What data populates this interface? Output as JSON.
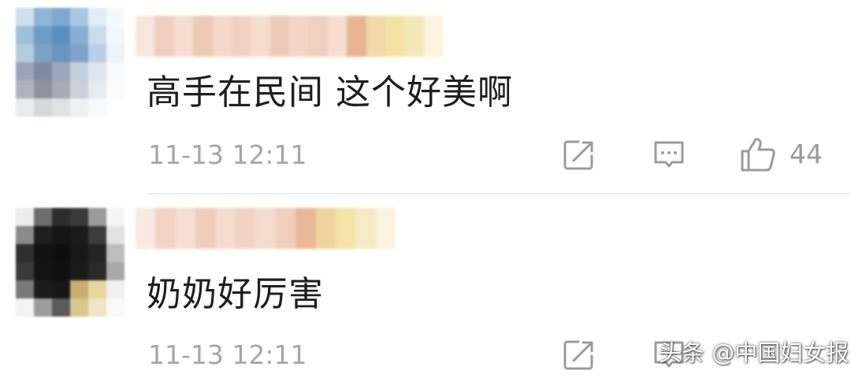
{
  "comments": [
    {
      "text": "高手在民间 这个好美啊",
      "timestamp": "11-13 12:11",
      "likes": "44",
      "avatar_palette": [
        "#cfe0ee",
        "#8fb6d8",
        "#7fa9d0",
        "#a9c7e2",
        "#e2eef7",
        "#f6f9fc",
        "#9fbfdc",
        "#6f9cc6",
        "#5d8fbd",
        "#88afd3",
        "#c9dcec",
        "#f3f7fb",
        "#b6cbe0",
        "#7fa1c3",
        "#6c94bc",
        "#7ea3c7",
        "#b9cfe3",
        "#eef3f8",
        "#9aa6b8",
        "#7f8aa2",
        "#9aa7bb",
        "#c4cfdc",
        "#dde5ee",
        "#f7f9fb",
        "#b0b3bd",
        "#8e939f",
        "#a6aab4",
        "#ccd0d8",
        "#e7eaee",
        "#fbfbfc",
        "#e9ebee",
        "#d4d7dc",
        "#dfe1e5",
        "#eef0f2",
        "#f8f9fa",
        "#ffffff"
      ],
      "username_palette": [
        "#f7e6dc",
        "#f0cfc0",
        "#f6ddd0",
        "#eccab6",
        "#f4d9cb",
        "#f1d2c2",
        "#f5dccf",
        "#eecbb8",
        "#f3d6c7",
        "#f0d0bf",
        "#f6ddcf",
        "#e8b592",
        "#f1d9a8",
        "#f3e2a0",
        "#f5e8b8",
        "#fbf3dc"
      ]
    },
    {
      "text": "奶奶好厉害",
      "timestamp": "11-13 12:11",
      "avatar_palette": [
        "#ececec",
        "#6d6d6d",
        "#2c2c2c",
        "#3a3a3a",
        "#9a9a9a",
        "#f5f5f5",
        "#8a8a8a",
        "#1e1e1e",
        "#151515",
        "#1b1b1b",
        "#3c3c3c",
        "#e2e2e2",
        "#2f2f2f",
        "#121212",
        "#0e0e0e",
        "#181818",
        "#242424",
        "#bdbdbd",
        "#3a3a3a",
        "#141414",
        "#101010",
        "#1a1a1a",
        "#2a2a2a",
        "#a8a8a8",
        "#7a7a7a",
        "#1c1c1c",
        "#171717",
        "#c9b070",
        "#e8d79a",
        "#f0f0f0",
        "#f3f3f3",
        "#9c9c9c",
        "#5a5a5a",
        "#d8c690",
        "#ece5c8",
        "#fafafa"
      ],
      "username_palette": [
        "#f8e8df",
        "#f2d4c5",
        "#f6dfd2",
        "#efcdbb",
        "#f5dccf",
        "#f1d3c3",
        "#f4dbcd",
        "#eed0bd",
        "#e9b896",
        "#efd4a0",
        "#f4e4a8",
        "#f6ebc2",
        "#fbf4e0"
      ]
    }
  ],
  "icons": {
    "share": "share-icon",
    "reply": "comment-icon",
    "like": "thumbs-up-icon"
  },
  "icon_color": "#9b9b9b",
  "watermark": "头条 @中国妇女报"
}
